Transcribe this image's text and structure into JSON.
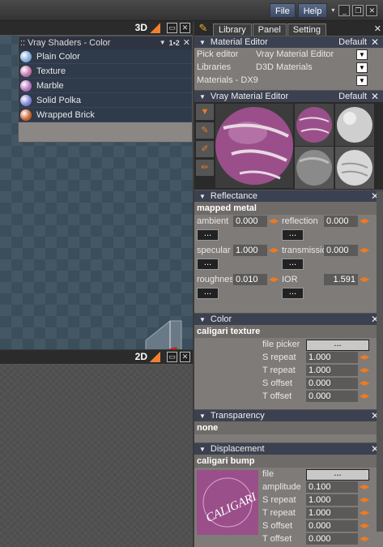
{
  "top_menu": {
    "file": "File",
    "help": "Help"
  },
  "viewport3d": {
    "label": "3D",
    "min": "▭",
    "close": "✕"
  },
  "shader_panel": {
    "title": ":: Vray Shaders - Color",
    "badge": "1•2",
    "items": [
      {
        "label": "Plain Color",
        "color": "#7da7d8"
      },
      {
        "label": "Texture",
        "color": "#c06fa8"
      },
      {
        "label": "Marble",
        "color": "#b070b8"
      },
      {
        "label": "Solid Polka",
        "color": "#7a7fd0"
      },
      {
        "label": "Wrapped Brick",
        "color": "#c8602a"
      }
    ]
  },
  "viewport2d": {
    "label": "2D",
    "min": "▭",
    "close": "✕"
  },
  "tabs": [
    "Library",
    "Panel",
    "Setting"
  ],
  "material_editor": {
    "title": "Material Editor",
    "mode": "Default",
    "rows": [
      {
        "label": "Pick editor",
        "value": "Vray Material Editor"
      },
      {
        "label": "Libraries",
        "value": "D3D Materials"
      },
      {
        "label": "",
        "value": "Materials - DX9"
      }
    ]
  },
  "vray_editor": {
    "title": "Vray Material Editor",
    "mode": "Default"
  },
  "reflectance": {
    "title": "Reflectance",
    "subtitle": "mapped metal",
    "ambient": {
      "label": "ambient",
      "value": "0.000"
    },
    "reflection": {
      "label": "reflection",
      "value": "0.000"
    },
    "specular": {
      "label": "specular",
      "value": "1.000"
    },
    "transmission": {
      "label": "transmissio",
      "value": "0.000"
    },
    "roughness": {
      "label": "roughnes",
      "value": "0.010"
    },
    "ior": {
      "label": "IOR",
      "value": "1.591"
    },
    "dots": "..."
  },
  "color": {
    "title": "Color",
    "subtitle": "caligari texture",
    "file_picker": {
      "label": "file picker",
      "button": "..."
    },
    "s_repeat": {
      "label": "S repeat",
      "value": "1.000"
    },
    "t_repeat": {
      "label": "T repeat",
      "value": "1.000"
    },
    "s_offset": {
      "label": "S offset",
      "value": "0.000"
    },
    "t_offset": {
      "label": "T offset",
      "value": "0.000"
    }
  },
  "transparency": {
    "title": "Transparency",
    "subtitle": "none"
  },
  "displacement": {
    "title": "Displacement",
    "subtitle": "caligari bump",
    "logo_text": "CALIGARI",
    "file": {
      "label": "file",
      "button": "..."
    },
    "amplitude": {
      "label": "amplitude",
      "value": "0.100"
    },
    "s_repeat": {
      "label": "S repeat",
      "value": "1.000"
    },
    "t_repeat": {
      "label": "T repeat",
      "value": "1.000"
    },
    "s_offset": {
      "label": "S offset",
      "value": "0.000"
    },
    "t_offset": {
      "label": "T offset",
      "value": "0.000"
    }
  }
}
